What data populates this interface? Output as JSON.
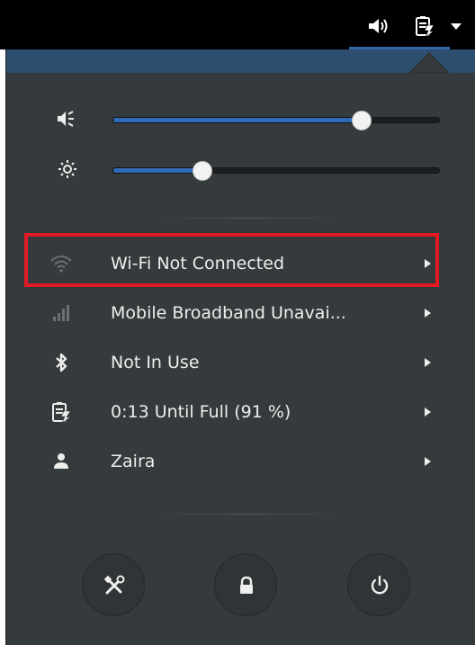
{
  "top_bar": {
    "indicators": [
      {
        "icon": "volume-icon"
      },
      {
        "icon": "battery-charging-icon"
      },
      {
        "icon": "menu-arrow-down-icon"
      }
    ]
  },
  "system_menu": {
    "sliders": [
      {
        "name": "volume",
        "icon": "speaker-icon",
        "value": 0.76
      },
      {
        "name": "brightness",
        "icon": "brightness-icon",
        "value": 0.27
      }
    ],
    "items": [
      {
        "icon": "wifi-icon",
        "label": "Wi-Fi Not Connected",
        "highlighted": true
      },
      {
        "icon": "mobile-signal-icon",
        "label": "Mobile Broadband Unavai..."
      },
      {
        "icon": "bluetooth-icon",
        "label": "Not In Use"
      },
      {
        "icon": "battery-icon",
        "label": "0:13 Until Full (91 %)"
      },
      {
        "icon": "user-icon",
        "label": "Zaira"
      }
    ],
    "buttons": [
      {
        "icon": "settings-icon"
      },
      {
        "icon": "lock-icon"
      },
      {
        "icon": "power-icon"
      }
    ]
  },
  "colors": {
    "menu_bg": "#353a3c",
    "accent": "#2e6bb8",
    "highlight_box": "#e01b24"
  }
}
